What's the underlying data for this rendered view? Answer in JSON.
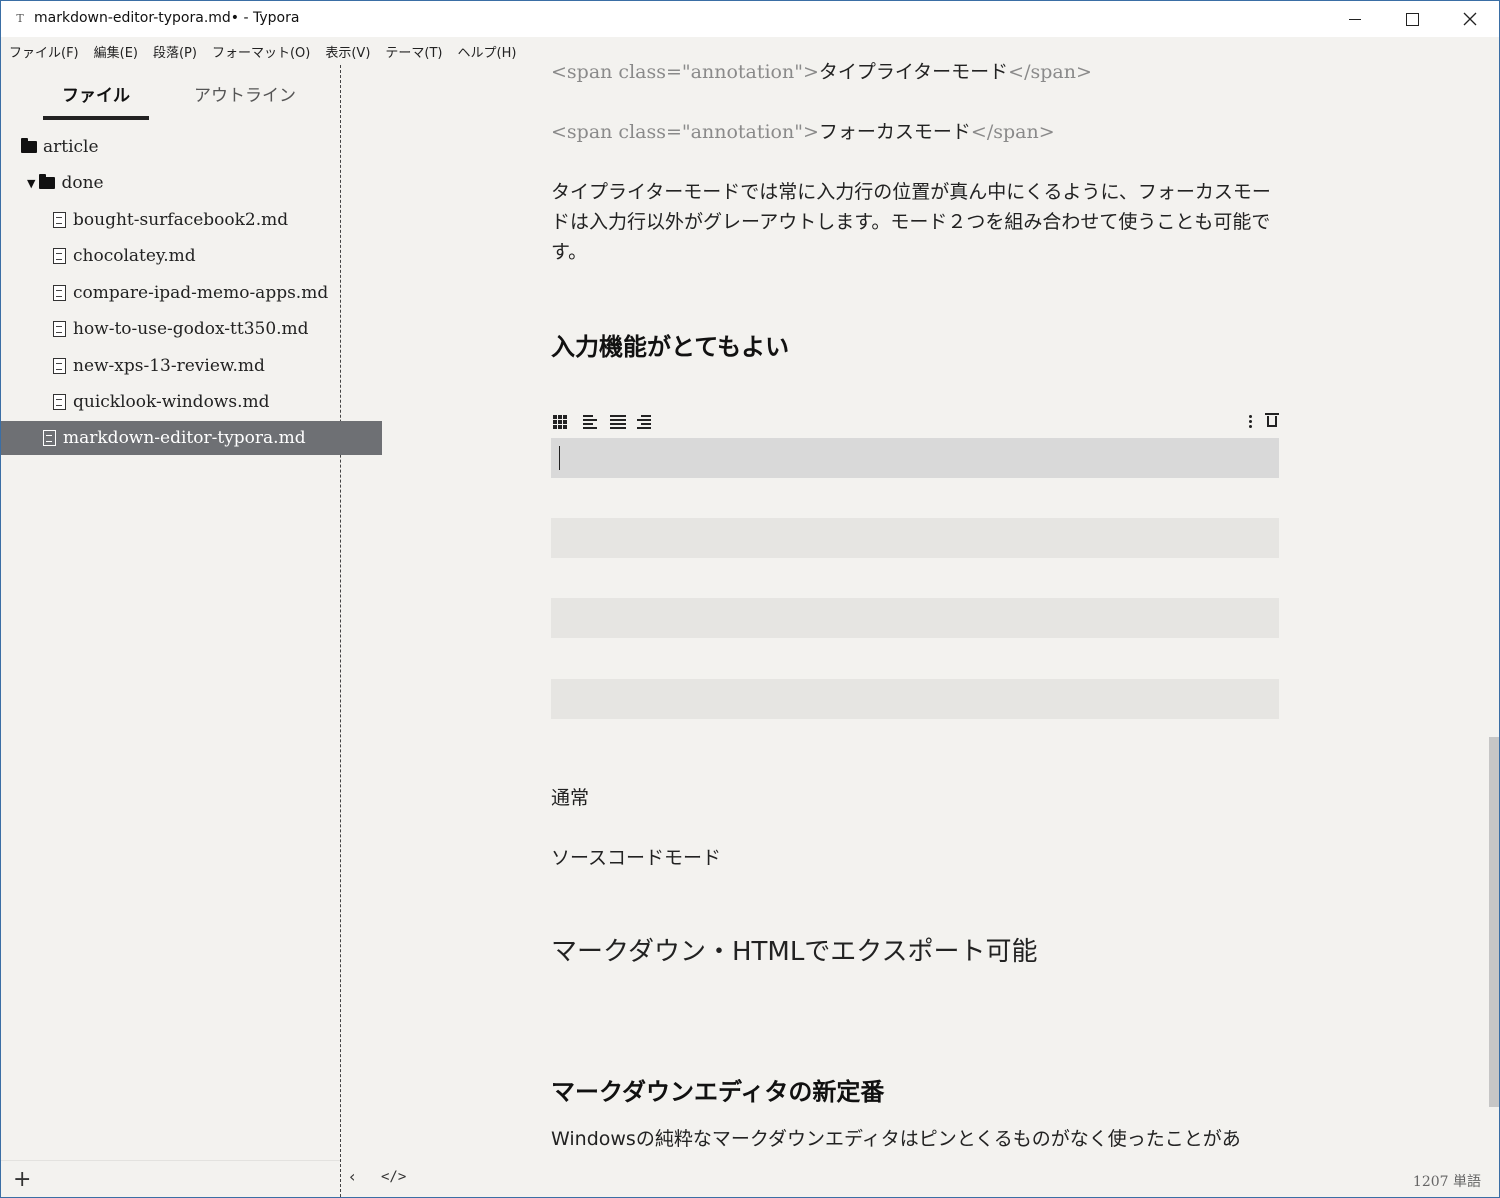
{
  "window": {
    "title": "markdown-editor-typora.md• - Typora",
    "app_icon": "T"
  },
  "menu": [
    "ファイル(F)",
    "編集(E)",
    "段落(P)",
    "フォーマット(O)",
    "表示(V)",
    "テーマ(T)",
    "ヘルプ(H)"
  ],
  "sidebar": {
    "tabs": [
      "ファイル",
      "アウトライン"
    ],
    "tree": [
      {
        "type": "folder",
        "label": "article"
      },
      {
        "type": "folder-open",
        "label": "done"
      },
      {
        "type": "file",
        "label": "bought-surfacebook2.md"
      },
      {
        "type": "file",
        "label": "chocolatey.md"
      },
      {
        "type": "file",
        "label": "compare-ipad-memo-apps.md"
      },
      {
        "type": "file",
        "label": "how-to-use-godox-tt350.md"
      },
      {
        "type": "file",
        "label": "new-xps-13-review.md"
      },
      {
        "type": "file",
        "label": "quicklook-windows.md"
      },
      {
        "type": "file",
        "label": "markdown-editor-typora.md",
        "active": true
      }
    ],
    "add_label": "+"
  },
  "editor": {
    "line1": {
      "tag_open": "<span class=\"annotation\">",
      "text": "タイプライターモード",
      "tag_close": "</span>"
    },
    "line2": {
      "tag_open": "<span class=\"annotation\">",
      "text": "フォーカスモード",
      "tag_close": "</span>"
    },
    "paragraph1": "タイプライターモードでは常に入力行の位置が真ん中にくるように、フォーカスモードは入力行以外がグレーアウトします。モード２つを組み合わせて使うことも可能です。",
    "heading1": "入力機能がとてもよい",
    "table_rows": 4,
    "text_normal": "通常",
    "text_source": "ソースコードモード",
    "large_text": "マークダウン・HTMLでエクスポート可能",
    "heading2": "マークダウンエディタの新定番",
    "paragraph2": "Windowsの純粋なマークダウンエディタはピンとくるものがなく使ったことがあ"
  },
  "bottom": {
    "back": "‹",
    "code": "</>",
    "word_count": "1207 単語"
  },
  "colors": {
    "background": "#f3f2ef",
    "active_file": "#6e7074",
    "table_row": "#e6e5e2"
  }
}
